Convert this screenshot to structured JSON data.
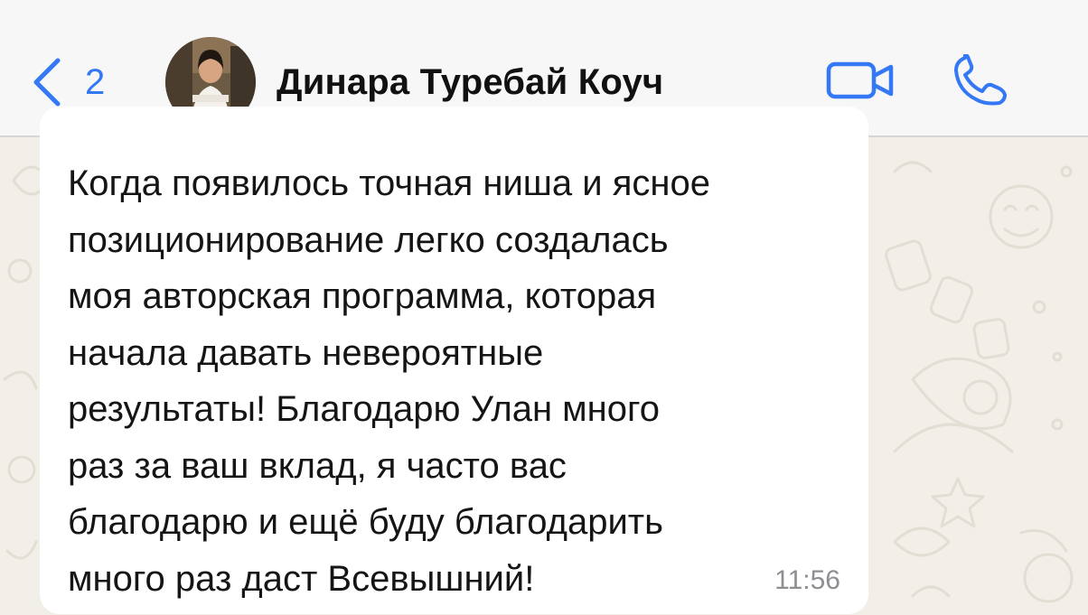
{
  "header": {
    "back_count": "2",
    "contact_name": "Динара Туребай Коуч",
    "icons": {
      "back": "chevron-left-icon",
      "video": "video-camera-icon",
      "phone": "phone-icon"
    },
    "accent_color": "#3478f6"
  },
  "message": {
    "text": "Когда появилось точная ниша и ясное\nпозиционирование легко создалась\nмоя авторская программа, которая\nначала давать невероятные\nрезультаты! Благодарю Улан много\nраз за ваш вклад, я часто вас\nблагодарю и ещё буду благодарить\nмного раз даст Всевышний!",
    "time": "11:56"
  }
}
